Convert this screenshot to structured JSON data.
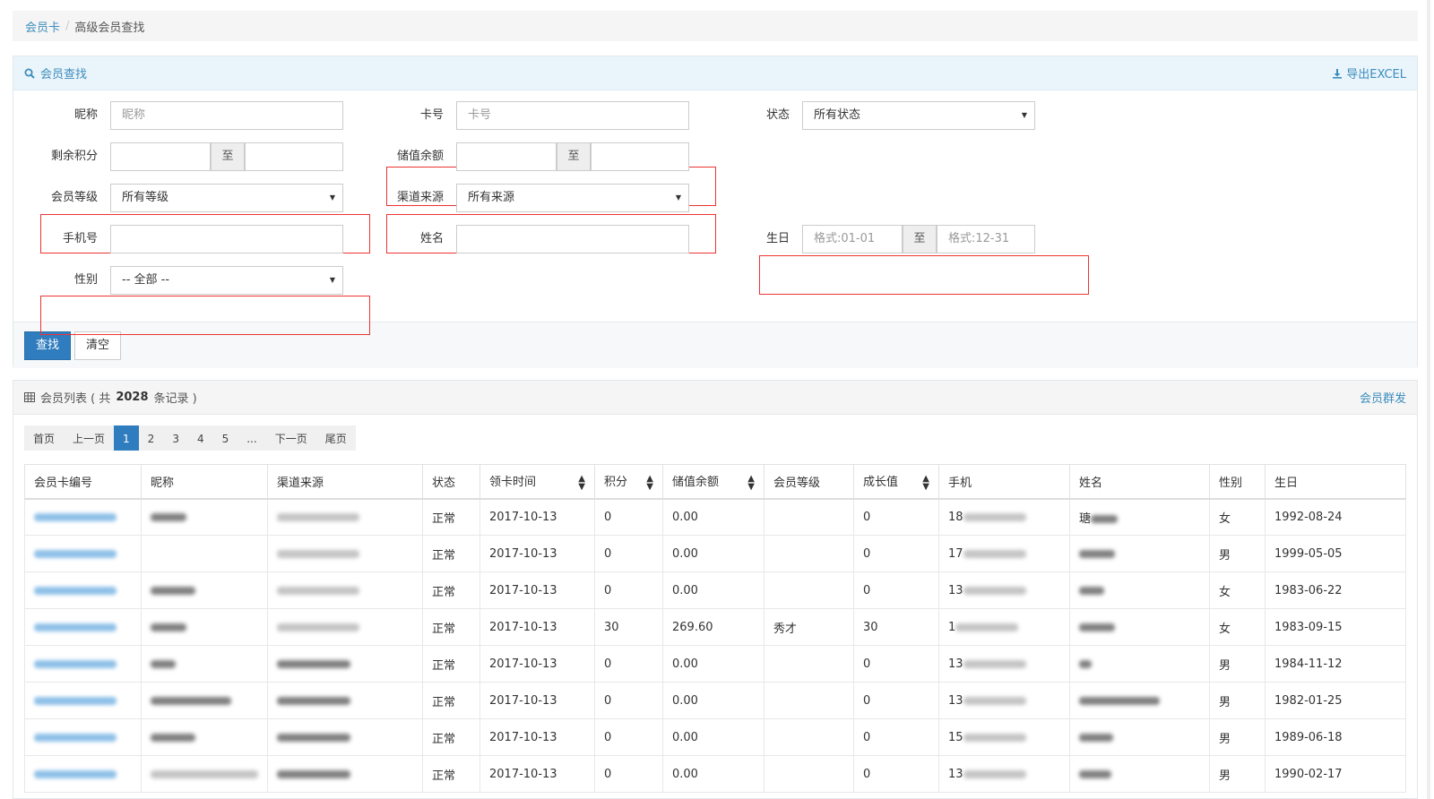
{
  "breadcrumb": {
    "root": "会员卡",
    "sep": "/",
    "current": "高级会员查找"
  },
  "search": {
    "title": "会员查找",
    "export_label": "导出EXCEL",
    "fields": {
      "nickname_label": "昵称",
      "nickname_placeholder": "昵称",
      "card_label": "卡号",
      "card_placeholder": "卡号",
      "status_label": "状态",
      "status_value": "所有状态",
      "points_label": "剩余积分",
      "range_sep": "至",
      "balance_label": "储值余额",
      "level_label": "会员等级",
      "level_value": "所有等级",
      "channel_label": "渠道来源",
      "channel_value": "所有来源",
      "phone_label": "手机号",
      "name_label": "姓名",
      "birthday_label": "生日",
      "birthday_from_placeholder": "格式:01-01",
      "birthday_to_placeholder": "格式:12-31",
      "gender_label": "性别",
      "gender_value": "-- 全部 --"
    },
    "search_button": "查找",
    "clear_button": "清空"
  },
  "list": {
    "title_prefix": "会员列表 ( 共 ",
    "total": "2028",
    "title_suffix": " 条记录 )",
    "mass_send": "会员群发",
    "pager": [
      "首页",
      "上一页",
      "1",
      "2",
      "3",
      "4",
      "5",
      "...",
      "下一页",
      "尾页"
    ],
    "active_page": "1",
    "columns": [
      "会员卡编号",
      "昵称",
      "渠道来源",
      "状态",
      "领卡时间",
      "积分",
      "储值余额",
      "会员等级",
      "成长值",
      "手机",
      "姓名",
      "性别",
      "生日"
    ],
    "rows": [
      {
        "status": "正常",
        "date": "2017-10-13",
        "points": "0",
        "balance": "0.00",
        "level": "",
        "growth": "0",
        "phone_prefix": "18",
        "name_prefix": "瑭",
        "gender": "女",
        "birthday": "1992-08-24"
      },
      {
        "status": "正常",
        "date": "2017-10-13",
        "points": "0",
        "balance": "0.00",
        "level": "",
        "growth": "0",
        "phone_prefix": "17",
        "name_prefix": "",
        "gender": "男",
        "birthday": "1999-05-05"
      },
      {
        "status": "正常",
        "date": "2017-10-13",
        "points": "0",
        "balance": "0.00",
        "level": "",
        "growth": "0",
        "phone_prefix": "13",
        "name_prefix": "",
        "gender": "女",
        "birthday": "1983-06-22"
      },
      {
        "status": "正常",
        "date": "2017-10-13",
        "points": "30",
        "balance": "269.60",
        "level": "秀才",
        "growth": "30",
        "phone_prefix": "1",
        "name_prefix": "",
        "gender": "女",
        "birthday": "1983-09-15"
      },
      {
        "status": "正常",
        "date": "2017-10-13",
        "points": "0",
        "balance": "0.00",
        "level": "",
        "growth": "0",
        "phone_prefix": "13",
        "name_prefix": "",
        "gender": "男",
        "birthday": "1984-11-12"
      },
      {
        "status": "正常",
        "date": "2017-10-13",
        "points": "0",
        "balance": "0.00",
        "level": "",
        "growth": "0",
        "phone_prefix": "13",
        "name_prefix": "",
        "gender": "男",
        "birthday": "1982-01-25"
      },
      {
        "status": "正常",
        "date": "2017-10-13",
        "points": "0",
        "balance": "0.00",
        "level": "",
        "growth": "0",
        "phone_prefix": "15",
        "name_prefix": "",
        "gender": "男",
        "birthday": "1989-06-18"
      },
      {
        "status": "正常",
        "date": "2017-10-13",
        "points": "0",
        "balance": "0.00",
        "level": "",
        "growth": "0",
        "phone_prefix": "13",
        "name_prefix": "",
        "gender": "男",
        "birthday": "1990-02-17"
      }
    ]
  },
  "icons": {
    "search": "search-icon",
    "download": "download-icon",
    "table": "table-icon"
  },
  "colors": {
    "accent": "#3c8dbc",
    "primary_button": "#2f7dbf",
    "highlight_box": "#ee3333"
  }
}
